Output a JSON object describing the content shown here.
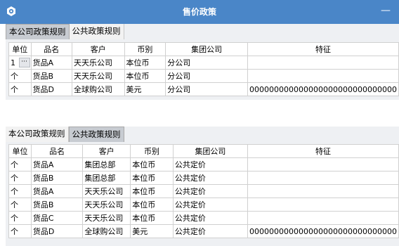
{
  "window": {
    "title": "售价政策",
    "minimize_glyph": "—"
  },
  "tabs": {
    "company": "本公司政策规则",
    "public": "公共政策规则"
  },
  "columns": [
    "单位",
    "品名",
    "客户",
    "币别",
    "集团公司",
    "特征"
  ],
  "grid1_rows": [
    {
      "unit": "1",
      "name": "货品A",
      "customer": "天天乐公司",
      "currency": "本位币",
      "group": "分公司",
      "feature": ""
    },
    {
      "unit": "个",
      "name": "货品B",
      "customer": "天天乐公司",
      "currency": "本位币",
      "group": "分公司",
      "feature": ""
    },
    {
      "unit": "个",
      "name": "货品D",
      "customer": "全球购公司",
      "currency": "美元",
      "group": "分公司",
      "feature": "000000000000000000000000000000"
    }
  ],
  "grid1_ellipsis": "···",
  "grid2_rows": [
    {
      "unit": "个",
      "name": "货品A",
      "customer": "集团总部",
      "currency": "本位币",
      "group": "公共定价",
      "feature": ""
    },
    {
      "unit": "个",
      "name": "货品B",
      "customer": "集团总部",
      "currency": "本位币",
      "group": "公共定价",
      "feature": ""
    },
    {
      "unit": "个",
      "name": "货品A",
      "customer": "天天乐公司",
      "currency": "本位币",
      "group": "公共定价",
      "feature": ""
    },
    {
      "unit": "个",
      "name": "货品B",
      "customer": "天天乐公司",
      "currency": "本位币",
      "group": "公共定价",
      "feature": ""
    },
    {
      "unit": "个",
      "name": "货品C",
      "customer": "天天乐公司",
      "currency": "本位币",
      "group": "公共定价",
      "feature": ""
    },
    {
      "unit": "个",
      "name": "货品D",
      "customer": "全球购公司",
      "currency": "美元",
      "group": "公共定价",
      "feature": "000000000000000000000000000000"
    }
  ],
  "colors": {
    "titlebar": "#4a86c8",
    "active_tab": "#c7cbd1"
  }
}
